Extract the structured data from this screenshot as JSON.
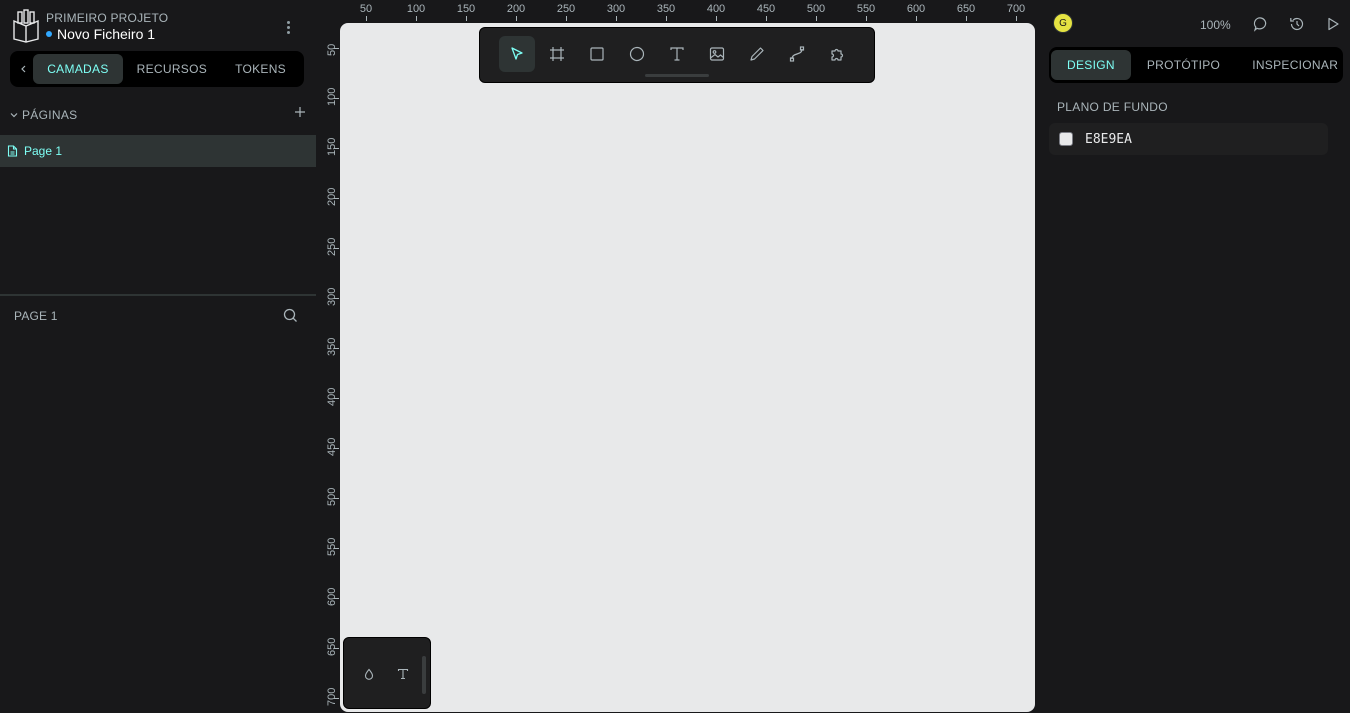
{
  "project": {
    "name": "PRIMEIRO PROJETO",
    "file_name": "Novo Ficheiro 1"
  },
  "left_tabs": [
    {
      "label": "CAMADAS",
      "active": true
    },
    {
      "label": "RECURSOS",
      "active": false
    },
    {
      "label": "TOKENS",
      "active": false
    }
  ],
  "pages": {
    "header": "PÁGINAS",
    "items": [
      {
        "label": "Page 1",
        "active": true
      }
    ]
  },
  "layers": {
    "header": "PAGE 1"
  },
  "ruler": {
    "top": [
      "50",
      "100",
      "150",
      "200",
      "250",
      "300",
      "350",
      "400",
      "450",
      "500",
      "550",
      "600",
      "650",
      "700"
    ],
    "left": [
      "50",
      "100",
      "150",
      "200",
      "250",
      "300",
      "350",
      "400",
      "450",
      "500",
      "550",
      "600",
      "650",
      "700"
    ]
  },
  "toolbar": {
    "tools": [
      {
        "name": "move-tool",
        "icon": "cursor-icon",
        "active": true
      },
      {
        "name": "board-tool",
        "icon": "board-icon",
        "active": false
      },
      {
        "name": "rectangle-tool",
        "icon": "rectangle-icon",
        "active": false
      },
      {
        "name": "ellipse-tool",
        "icon": "ellipse-icon",
        "active": false
      },
      {
        "name": "text-tool",
        "icon": "text-icon",
        "active": false
      },
      {
        "name": "image-tool",
        "icon": "image-icon",
        "active": false
      },
      {
        "name": "pencil-tool",
        "icon": "pencil-icon",
        "active": false
      },
      {
        "name": "path-tool",
        "icon": "path-icon",
        "active": false
      },
      {
        "name": "plugins-tool",
        "icon": "puzzle-icon",
        "active": false
      }
    ]
  },
  "palette": {
    "buttons": [
      "drop-icon",
      "text-icon"
    ]
  },
  "header_right": {
    "avatar_initial": "G",
    "zoom": "100%"
  },
  "right_tabs": [
    {
      "label": "DESIGN",
      "active": true
    },
    {
      "label": "PROTÓTIPO",
      "active": false
    },
    {
      "label": "INSPECIONAR",
      "active": false
    }
  ],
  "background": {
    "label": "PLANO DE FUNDO",
    "hex": "E8E9EA",
    "color": "#e8e9ea"
  },
  "colors": {
    "accent": "#7efff5",
    "panel": "#18181a",
    "canvas": "#e8e9ea",
    "selected_bg": "#2e3434",
    "muted_text": "#aab5ba"
  }
}
